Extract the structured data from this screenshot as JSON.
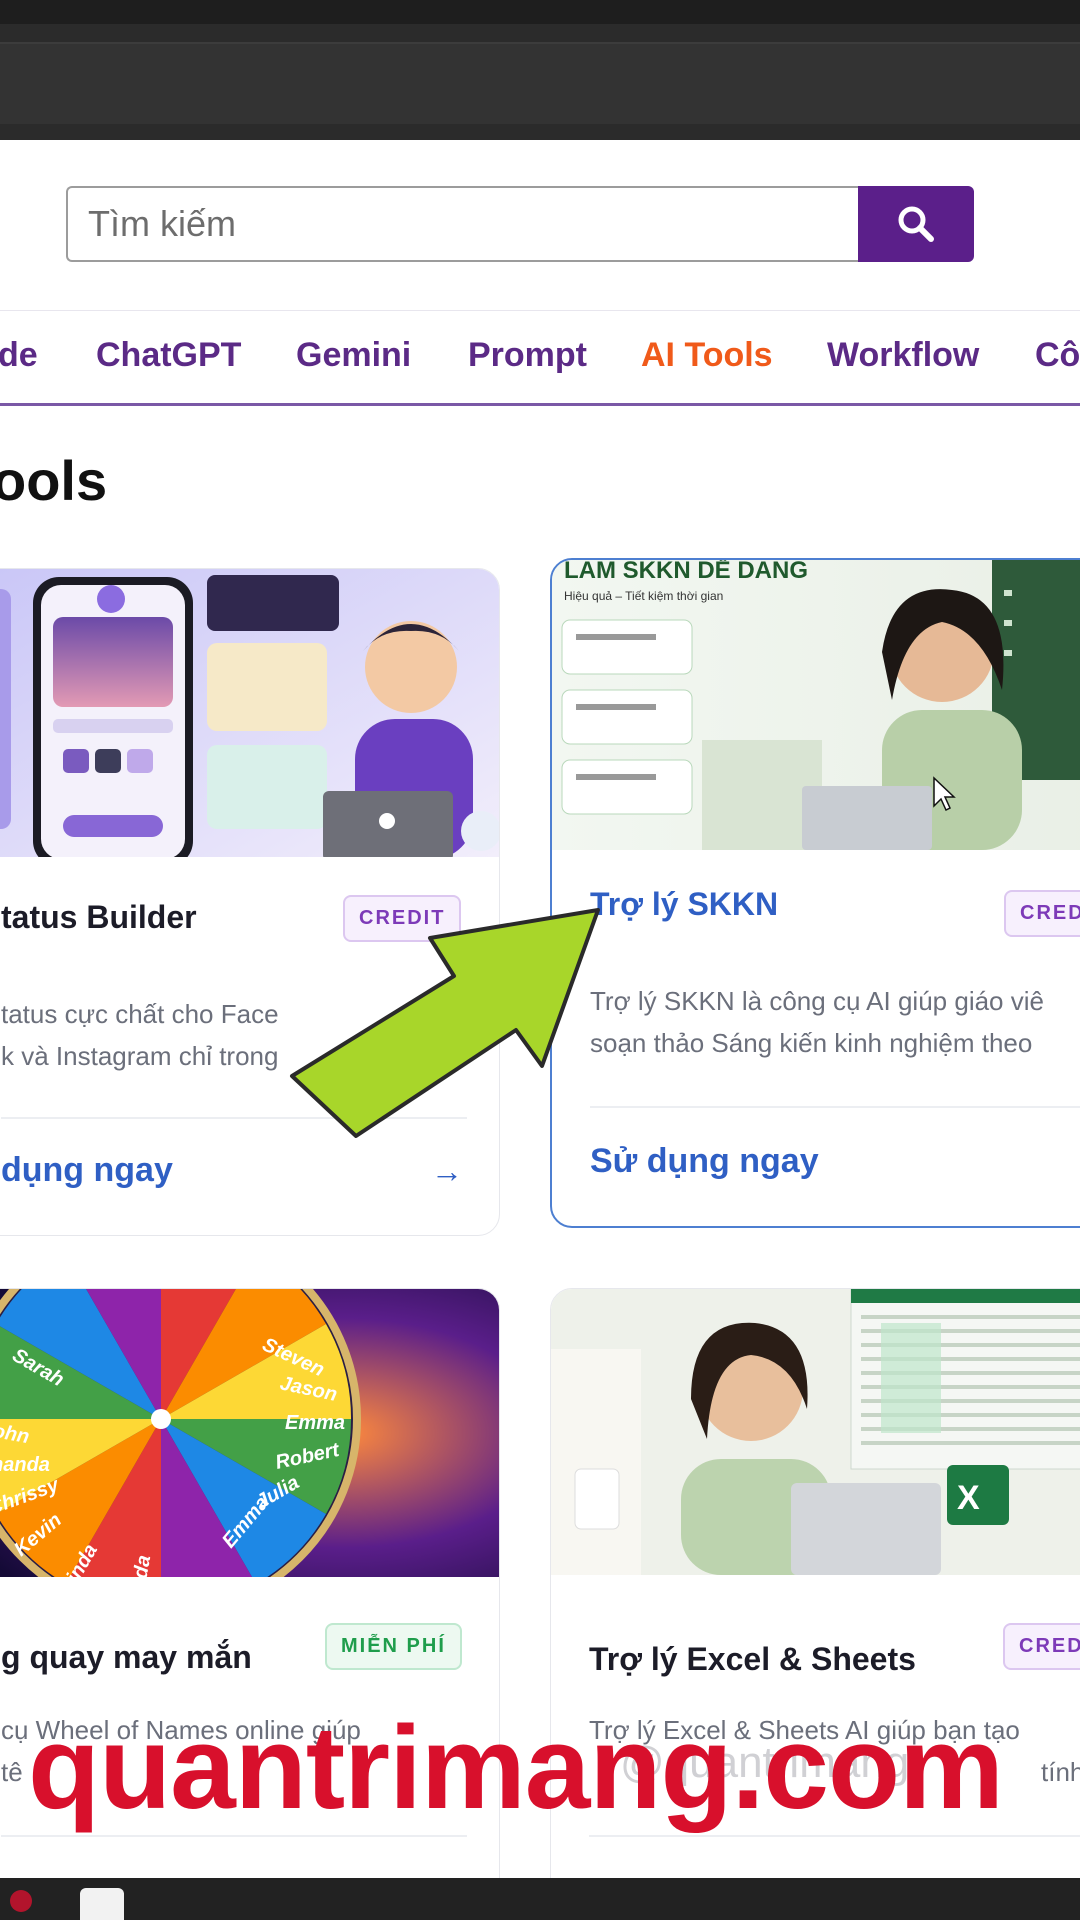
{
  "search": {
    "placeholder": "Tìm kiếm"
  },
  "nav": {
    "items": [
      {
        "label": "de"
      },
      {
        "label": "ChatGPT"
      },
      {
        "label": "Gemini"
      },
      {
        "label": "Prompt"
      },
      {
        "label": "AI Tools"
      },
      {
        "label": "Workflow"
      },
      {
        "label": "Cô"
      }
    ],
    "active": "AI Tools"
  },
  "section": {
    "title": "ools"
  },
  "image_text": {
    "skkn_banner": "LÀM SKKN DỄ DÀNG",
    "skkn_sub": "Hiệu quả – Tiết kiệm thời gian",
    "wheel_names": [
      "John",
      "Amanda",
      "Chrissy",
      "Kevin",
      "Linda",
      "Linda",
      "Sarah",
      "Steven",
      "Jason",
      "Emma",
      "Robert",
      "Julia",
      "Emma"
    ]
  },
  "cards": [
    {
      "title": "tatus Builder",
      "badge": "CREDIT",
      "desc_line1": "tatus cực chất cho Face",
      "desc_line2": "k và Instagram chỉ trong",
      "cta": "dụng ngay",
      "arrow": "→"
    },
    {
      "title": "Trợ lý SKKN",
      "badge": "CRED",
      "desc_line1": "Trợ lý SKKN là công cụ AI giúp giáo viê",
      "desc_line2": "soạn thảo Sáng kiến kinh nghiệm theo",
      "cta": "Sử dụng ngay"
    },
    {
      "title": "g quay may mắn",
      "badge": "MIỄN PHÍ",
      "desc_line1": "cụ Wheel of Names online giúp",
      "desc_line2": "tê"
    },
    {
      "title": "Trợ lý Excel & Sheets",
      "badge": "CRED",
      "desc_line1": "Trợ lý Excel & Sheets AI giúp bạn tạo",
      "desc_line2": "tính v"
    }
  ],
  "watermark": {
    "text": "quantrimang.com",
    "ghost": "@quantrimang"
  },
  "colors": {
    "brand_purple": "#5b1f8a",
    "nav_text": "#5b2a86",
    "nav_active": "#f05a1a",
    "link_blue": "#2f5fc4",
    "watermark_red": "#d8102c",
    "arrow_green": "#a8d62a"
  }
}
